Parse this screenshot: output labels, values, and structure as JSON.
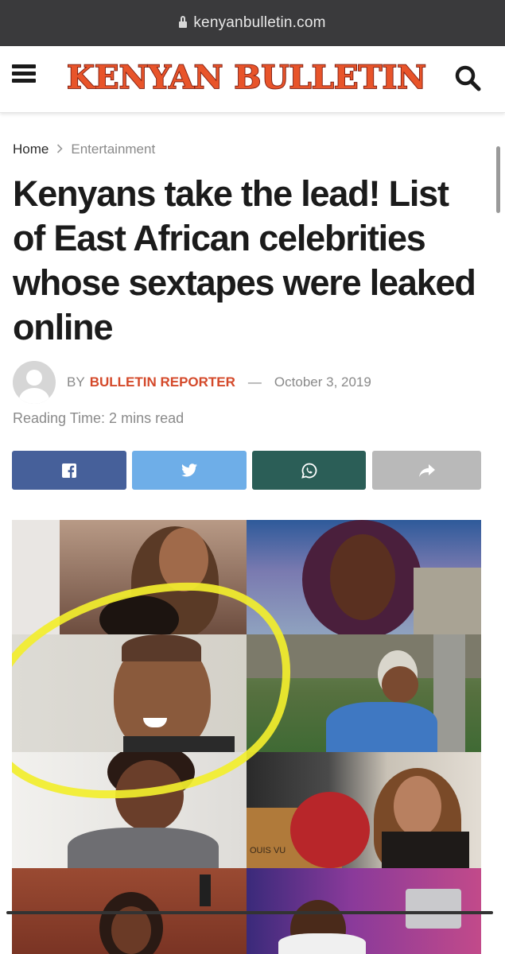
{
  "browser": {
    "url": "kenyanbulletin.com",
    "lock_icon": "lock-icon"
  },
  "header": {
    "menu_icon": "hamburger-menu-icon",
    "logo_text": "KENYAN BULLETIN",
    "search_icon": "search-icon",
    "logo_colors": {
      "fill": "#e8542a",
      "outline": "#7a1c10"
    }
  },
  "breadcrumb": {
    "home": "Home",
    "separator_icon": "chevron-right-icon",
    "current": "Entertainment"
  },
  "article": {
    "title": "Kenyans take the lead! List of East African celebrities whose sextapes were leaked online",
    "by_label": "BY",
    "author": "BULLETIN REPORTER",
    "dash": "—",
    "date": "October 3, 2019",
    "reading_time": "Reading Time: 2 mins read"
  },
  "share_buttons": [
    {
      "network": "facebook",
      "icon": "facebook-icon",
      "color": "#46609a"
    },
    {
      "network": "twitter",
      "icon": "twitter-icon",
      "color": "#6eaee8"
    },
    {
      "network": "whatsapp",
      "icon": "whatsapp-icon",
      "color": "#2b5e57"
    },
    {
      "network": "share",
      "icon": "share-arrow-icon",
      "color": "#b9b9b9"
    }
  ],
  "featured_image": {
    "photo_text": "OUIS VU",
    "highlight_color": "#f2ee2c"
  },
  "colors": {
    "accent": "#d4492a",
    "title": "#1b1b1b",
    "muted": "#8a8a8a",
    "browser_bar": "#3a3a3c"
  }
}
